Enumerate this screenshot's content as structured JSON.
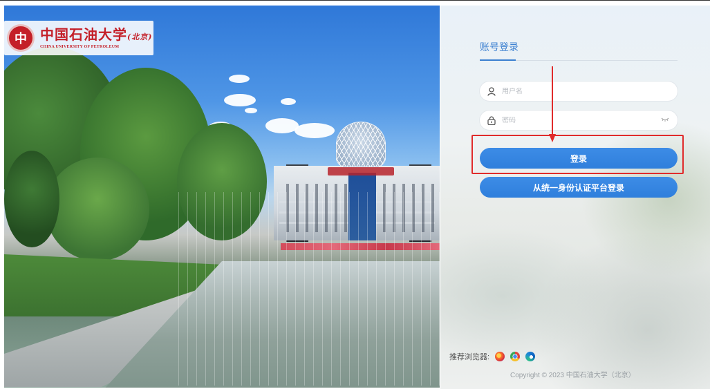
{
  "logo": {
    "name_cn": "中国石油大学",
    "name_cn_suffix": "(北京)",
    "name_en": "CHINA UNIVERSITY OF PETROLEUM",
    "seal_glyph": "中"
  },
  "login": {
    "tab_label": "账号登录",
    "username_placeholder": "用户名",
    "password_placeholder": "密码",
    "login_button": "登录",
    "sso_button": "从统一身份认证平台登录"
  },
  "footer": {
    "browsers_label": "推荐浏览器:",
    "browser_icons": [
      "firefox-icon",
      "chrome-icon",
      "edge-icon"
    ],
    "copyright": "Copyright © 2023 中国石油大学（北京）"
  },
  "colors": {
    "accent": "#3a7fd0",
    "brand_red": "#c41f28",
    "annotation_red": "#e02b2b"
  }
}
